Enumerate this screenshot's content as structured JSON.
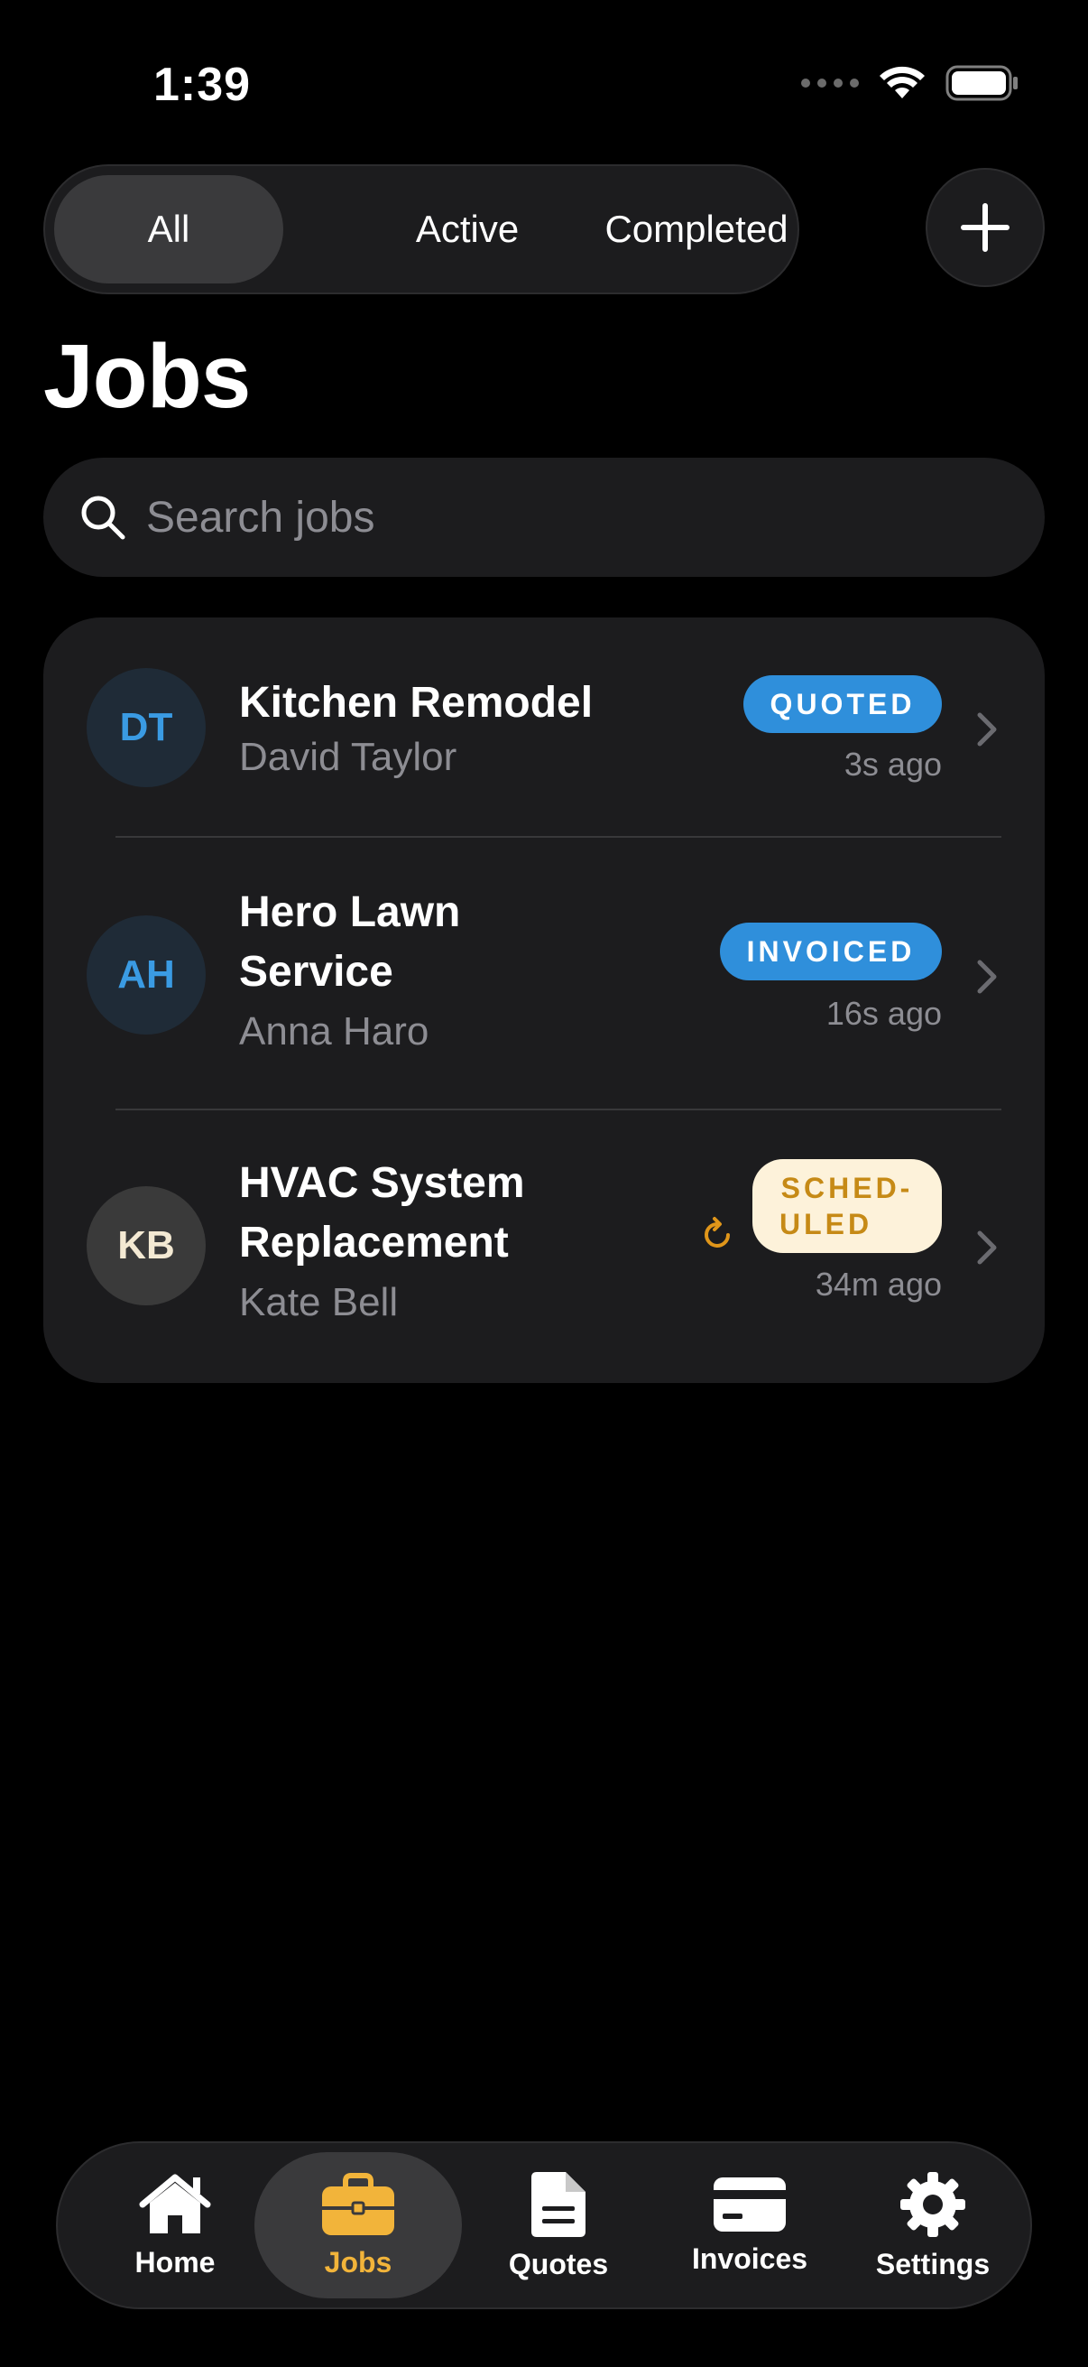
{
  "status_bar": {
    "time": "1:39"
  },
  "filters": {
    "items": [
      {
        "label": "All",
        "selected": true
      },
      {
        "label": "Active",
        "selected": false
      },
      {
        "label": "Completed",
        "selected": false
      }
    ]
  },
  "add_button": {
    "icon": "plus-icon"
  },
  "page_title": "Jobs",
  "search": {
    "placeholder": "Search jobs",
    "value": "",
    "icon": "search-icon"
  },
  "jobs": [
    {
      "initials": "DT",
      "title": "Kitchen Remodel",
      "client": "David Taylor",
      "status": "QUOTED",
      "time": "3s ago",
      "status_color": "#2f8fdb"
    },
    {
      "initials": "AH",
      "title_line1": "Hero Lawn",
      "title_line2": "Service",
      "client": "Anna Haro",
      "status": "INVOICED",
      "time": "16s ago",
      "status_color": "#2f8fdb"
    },
    {
      "initials": "KB",
      "title_line1": "HVAC System",
      "title_line2": "Replacement",
      "client": "Kate Bell",
      "status_line1": "SCHED-",
      "status_line2": "ULED",
      "time": "34m ago",
      "status_color": "#c68a16",
      "sync_icon": "refresh-icon"
    }
  ],
  "tabbar": {
    "items": [
      {
        "label": "Home",
        "icon": "home-icon",
        "active": false
      },
      {
        "label": "Jobs",
        "icon": "briefcase-icon",
        "active": true
      },
      {
        "label": "Quotes",
        "icon": "document-icon",
        "active": false
      },
      {
        "label": "Invoices",
        "icon": "credit-card-icon",
        "active": false
      },
      {
        "label": "Settings",
        "icon": "gear-icon",
        "active": false
      }
    ]
  },
  "colors": {
    "accent": "#f2b43a",
    "badge_blue": "#2f8fdb",
    "background": "#000000",
    "card": "#1c1c1e"
  }
}
